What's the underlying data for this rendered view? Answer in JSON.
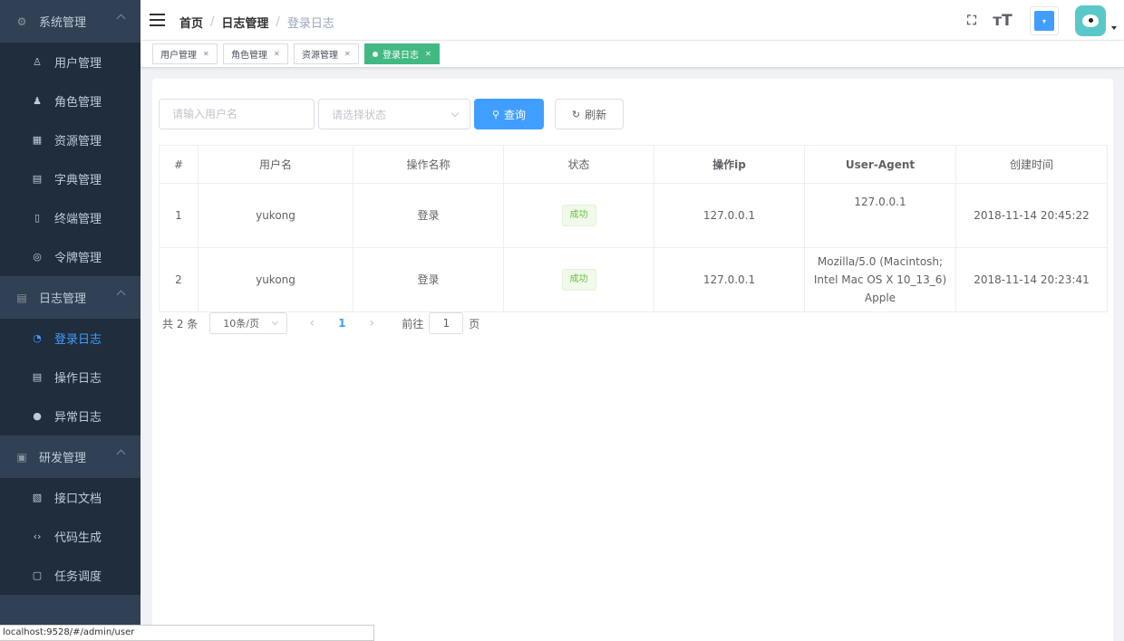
{
  "sidebar": {
    "groups": [
      {
        "label": "系统管理",
        "icon": "gear-icon",
        "items": [
          {
            "label": "用户管理",
            "icon": "user-icon"
          },
          {
            "label": "角色管理",
            "icon": "users-icon"
          },
          {
            "label": "资源管理",
            "icon": "grid-icon"
          },
          {
            "label": "字典管理",
            "icon": "book-icon"
          },
          {
            "label": "终端管理",
            "icon": "phone-icon"
          },
          {
            "label": "令牌管理",
            "icon": "token-icon"
          }
        ]
      },
      {
        "label": "日志管理",
        "icon": "document-icon",
        "items": [
          {
            "label": "登录日志",
            "icon": "login-log-icon",
            "active": true
          },
          {
            "label": "操作日志",
            "icon": "document-icon"
          },
          {
            "label": "异常日志",
            "icon": "warning-icon"
          }
        ]
      },
      {
        "label": "研发管理",
        "icon": "calendar-icon",
        "items": [
          {
            "label": "接口文档",
            "icon": "file-icon"
          },
          {
            "label": "代码生成",
            "icon": "code-icon"
          },
          {
            "label": "任务调度",
            "icon": "clipboard-icon"
          }
        ]
      }
    ]
  },
  "navbar": {
    "breadcrumb": [
      "首页",
      "日志管理",
      "登录日志"
    ],
    "separator": "/",
    "size_glyph": "тT"
  },
  "tags": [
    {
      "label": "用户管理",
      "active": false
    },
    {
      "label": "角色管理",
      "active": false
    },
    {
      "label": "资源管理",
      "active": false
    },
    {
      "label": "登录日志",
      "active": true
    }
  ],
  "filters": {
    "username_placeholder": "请输入用户名",
    "status_placeholder": "请选择状态",
    "search_label": "查询",
    "refresh_label": "刷新"
  },
  "table": {
    "columns": [
      "#",
      "用户名",
      "操作名称",
      "状态",
      "操作ip",
      "User-Agent",
      "创建时间"
    ],
    "rows": [
      {
        "index": "1",
        "username": "yukong",
        "operation": "登录",
        "status": "成功",
        "ip": "127.0.0.1",
        "user_agent": "127.0.0.1",
        "created": "2018-11-14 20:45:22"
      },
      {
        "index": "2",
        "username": "yukong",
        "operation": "登录",
        "status": "成功",
        "ip": "127.0.0.1",
        "user_agent": "Mozilla/5.0 (Macintosh; Intel Mac OS X 10_13_6) Apple",
        "created": "2018-11-14 20:23:41"
      }
    ]
  },
  "pagination": {
    "total": "共 2 条",
    "page_size": "10条/页",
    "current_page": "1",
    "jump_label": "前往",
    "jump_value": "1",
    "page_unit": "页"
  },
  "statusbar": {
    "url": "localhost:9528/#/admin/user"
  },
  "colors": {
    "sidebar_bg": "#304156",
    "submenu_bg": "#1f2d3d",
    "primary": "#409eff",
    "tag_active": "#42b983",
    "success": "#67c23a"
  }
}
